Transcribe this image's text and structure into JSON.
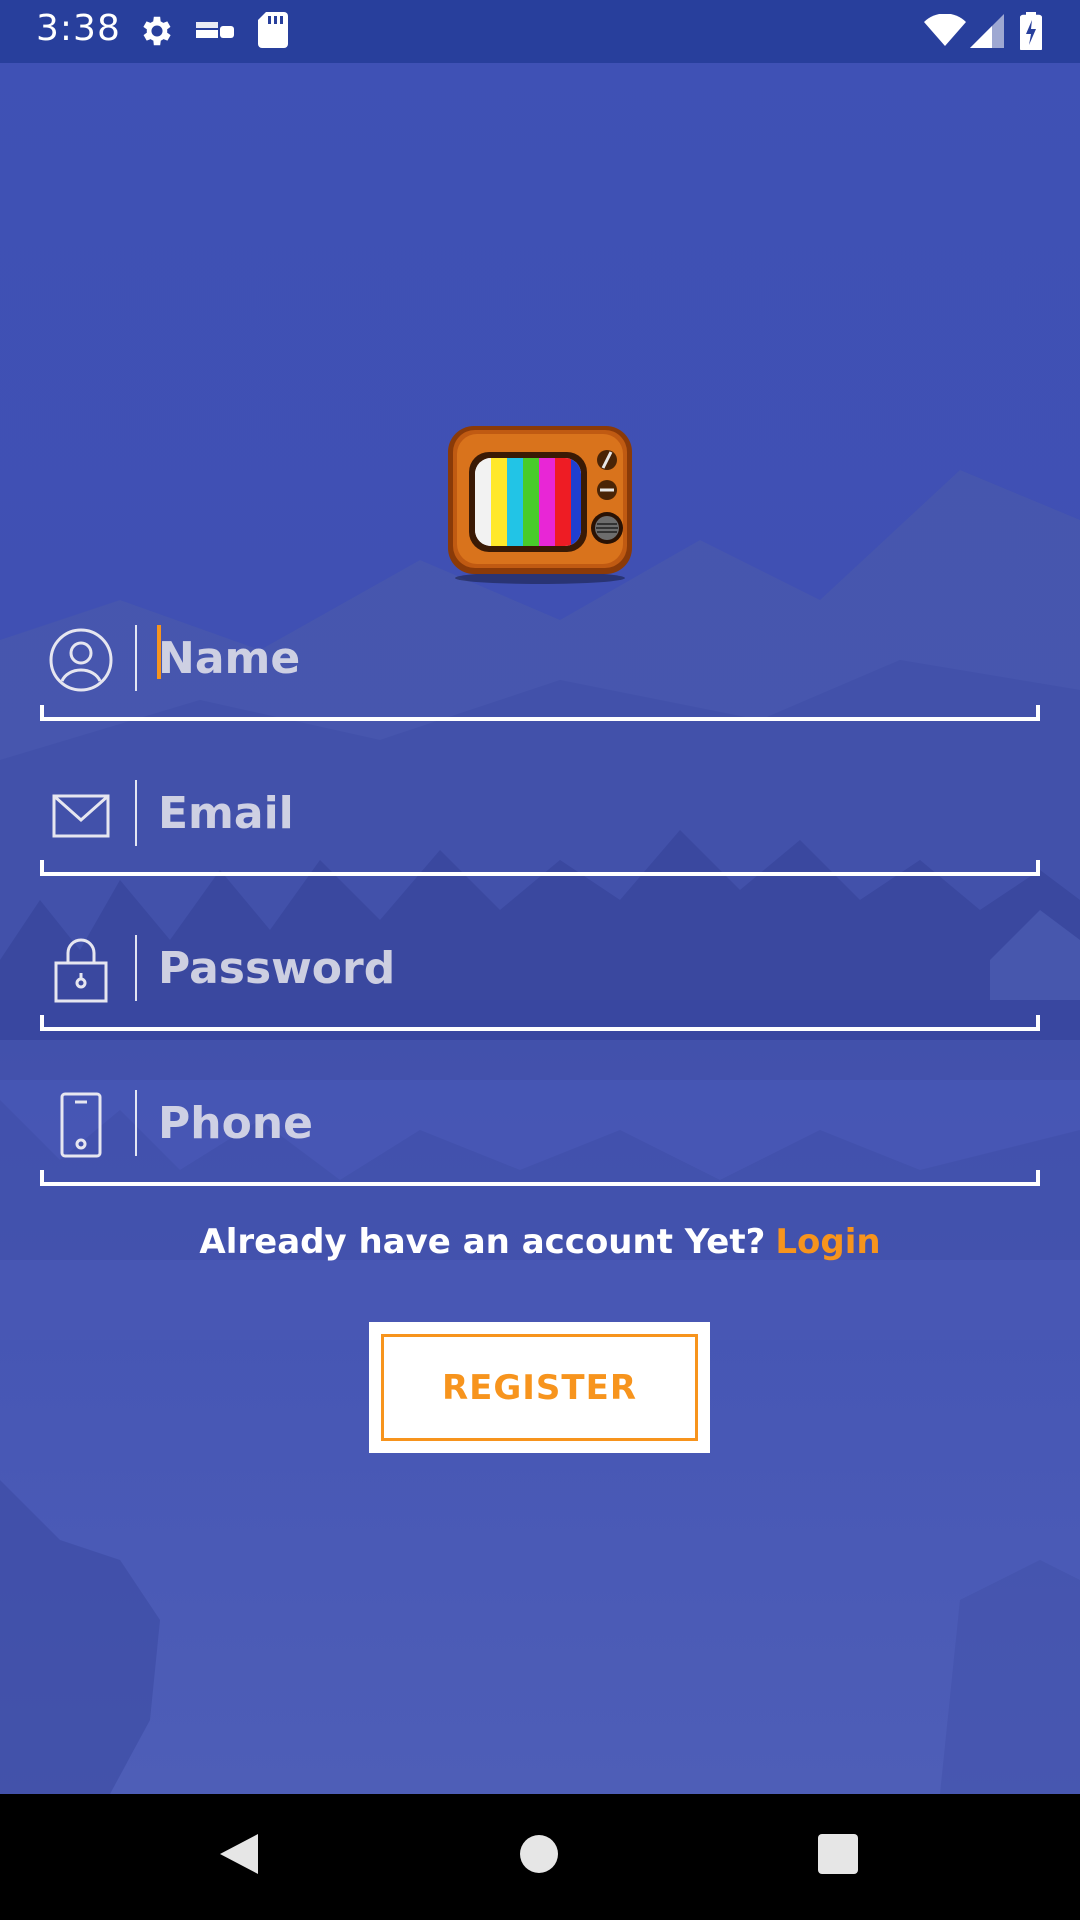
{
  "status_bar": {
    "time": "3:38",
    "icons": [
      "gear-icon",
      "android-live-icon",
      "sd-card-icon",
      "wifi-icon",
      "cell-signal-icon",
      "battery-charging-icon"
    ]
  },
  "app_logo": {
    "icon": "retro-tv-icon"
  },
  "form": {
    "name": {
      "placeholder": "Name",
      "value": "",
      "icon": "user-icon"
    },
    "email": {
      "placeholder": "Email",
      "value": "",
      "icon": "envelope-icon"
    },
    "password": {
      "placeholder": "Password",
      "value": "",
      "icon": "lock-icon"
    },
    "phone": {
      "placeholder": "Phone",
      "value": "",
      "icon": "phone-icon"
    }
  },
  "login_prompt": {
    "text": "Already have an account Yet?",
    "link": "Login"
  },
  "register_button": {
    "label": "REGISTER"
  },
  "nav_bar": {
    "icons": [
      "back-icon",
      "home-icon",
      "recents-icon"
    ]
  },
  "colors": {
    "accent": "#f7941d",
    "background": "#3f51b5",
    "status_bar": "#283f9c",
    "nav_bar": "#000000"
  }
}
